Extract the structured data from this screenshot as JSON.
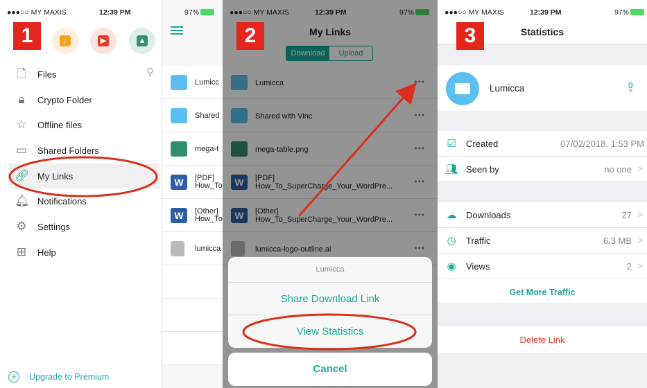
{
  "status": {
    "carrier": "●●●○○ MY MAXIS",
    "time": "12:39 PM",
    "battery": "97%"
  },
  "badges": [
    "1",
    "2",
    "3"
  ],
  "menu": {
    "items": [
      {
        "label": "Files",
        "icon": "file-icon"
      },
      {
        "label": "Crypto Folder",
        "icon": "lock-icon"
      },
      {
        "label": "Offline files",
        "icon": "star-icon"
      },
      {
        "label": "Shared Folders",
        "icon": "shared-folder-icon"
      },
      {
        "label": "My Links",
        "icon": "link-icon"
      },
      {
        "label": "Notifications",
        "icon": "bell-icon"
      },
      {
        "label": "Settings",
        "icon": "gear-icon"
      },
      {
        "label": "Help",
        "icon": "help-icon"
      }
    ],
    "premium": "Upgrade to Premium"
  },
  "files_partial": [
    "Lumicc",
    "Shared",
    "mega-t",
    "[PDF]\nHow_To",
    "[Other]\nHow_To",
    "lumicca"
  ],
  "mylinks": {
    "title": "My Links",
    "tabs": [
      "Download",
      "Upload"
    ],
    "rows": [
      {
        "name": "Lumicca",
        "type": "folder"
      },
      {
        "name": "Shared with Vinc",
        "type": "folder"
      },
      {
        "name": "mega-table.png",
        "type": "image"
      },
      {
        "name": "[PDF]\nHow_To_SuperCharge_Your_WordPre...",
        "type": "word"
      },
      {
        "name": "[Other]\nHow_To_SuperCharge_Your_WordPre...",
        "type": "word"
      },
      {
        "name": "lumicca-logo-outline.ai",
        "type": "generic"
      }
    ],
    "more": "•••",
    "sheet": {
      "title": "Lumicca",
      "share": "Share Download Link",
      "stats": "View Statistics",
      "cancel": "Cancel"
    }
  },
  "statistics": {
    "title": "Statistics",
    "name": "Lumicca",
    "created_label": "Created",
    "created_value": "07/02/2018, 1:53 PM",
    "seenby_label": "Seen by",
    "seenby_value": "no one",
    "downloads_label": "Downloads",
    "downloads_value": "27",
    "traffic_label": "Traffic",
    "traffic_value": "6.3 MB",
    "views_label": "Views",
    "views_value": "2",
    "more_traffic": "Get More Traffic",
    "delete": "Delete Link"
  },
  "colors": {
    "accent": "#1aa99b",
    "badge": "#e4251b",
    "annotation": "#d9301c",
    "delete": "#e0392b"
  }
}
